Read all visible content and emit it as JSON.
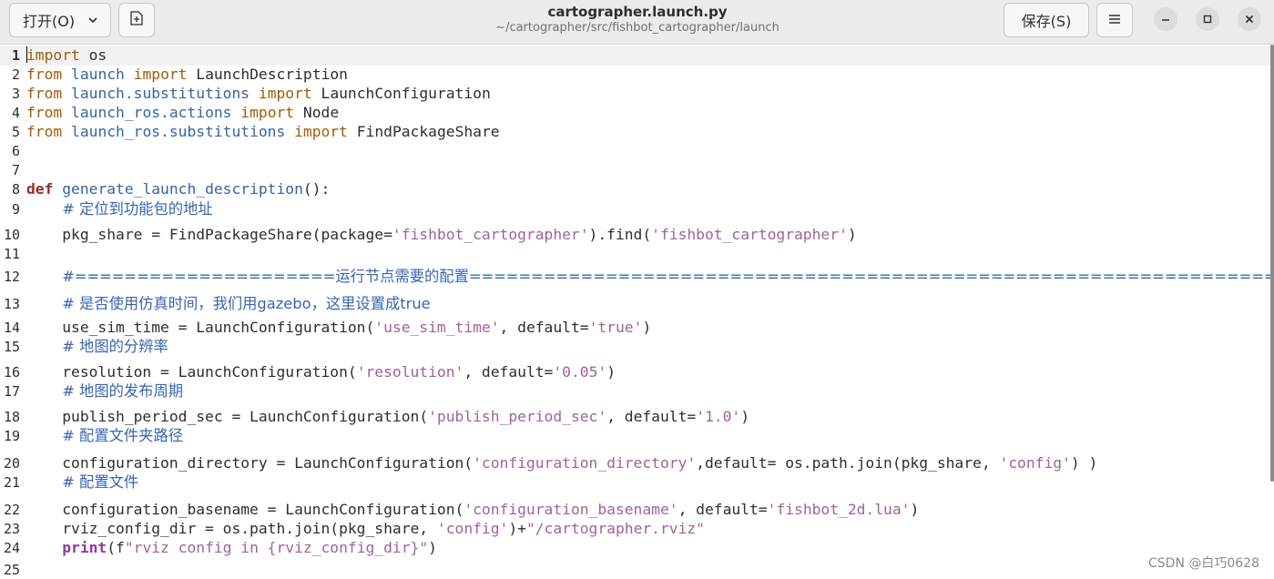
{
  "header": {
    "open_label": "打开(O)",
    "save_label": "保存(S)",
    "title": "cartographer.launch.py",
    "subtitle": "~/cartographer/src/fishbot_cartographer/launch"
  },
  "icons": {
    "open_dropdown": "chevron-down-icon",
    "new_document": "new-document-icon",
    "menu": "hamburger-menu-icon",
    "minimize": "minimize-icon",
    "maximize": "maximize-icon",
    "close": "close-icon"
  },
  "colors": {
    "keyword": "#a15c07",
    "module": "#3465a4",
    "string": "#a0629b",
    "comment": "#3a64b0",
    "builtin": "#8a3c9b",
    "def": "#a0292c"
  },
  "editor": {
    "current_line": 1,
    "lines": [
      {
        "n": "1",
        "segs": [
          [
            "kw",
            "import"
          ],
          [
            "plain",
            " os"
          ]
        ]
      },
      {
        "n": "2",
        "segs": [
          [
            "kw",
            "from"
          ],
          [
            "plain",
            " "
          ],
          [
            "mod",
            "launch"
          ],
          [
            "plain",
            " "
          ],
          [
            "kw",
            "import"
          ],
          [
            "plain",
            " LaunchDescription"
          ]
        ]
      },
      {
        "n": "3",
        "segs": [
          [
            "kw",
            "from"
          ],
          [
            "plain",
            " "
          ],
          [
            "mod",
            "launch.substitutions"
          ],
          [
            "plain",
            " "
          ],
          [
            "kw",
            "import"
          ],
          [
            "plain",
            " LaunchConfiguration"
          ]
        ]
      },
      {
        "n": "4",
        "segs": [
          [
            "kw",
            "from"
          ],
          [
            "plain",
            " "
          ],
          [
            "mod",
            "launch_ros.actions"
          ],
          [
            "plain",
            " "
          ],
          [
            "kw",
            "import"
          ],
          [
            "plain",
            " Node"
          ]
        ]
      },
      {
        "n": "5",
        "segs": [
          [
            "kw",
            "from"
          ],
          [
            "plain",
            " "
          ],
          [
            "mod",
            "launch_ros.substitutions"
          ],
          [
            "plain",
            " "
          ],
          [
            "kw",
            "import"
          ],
          [
            "plain",
            " FindPackageShare"
          ]
        ]
      },
      {
        "n": "6",
        "segs": []
      },
      {
        "n": "7",
        "segs": []
      },
      {
        "n": "8",
        "segs": [
          [
            "def",
            "def"
          ],
          [
            "plain",
            " "
          ],
          [
            "mod",
            "generate_launch_description"
          ],
          [
            "plain",
            "():"
          ]
        ]
      },
      {
        "n": "9",
        "segs": [
          [
            "plain",
            "    "
          ],
          [
            "cmt",
            "# 定位到功能包的地址"
          ]
        ]
      },
      {
        "n": "10",
        "segs": [
          [
            "plain",
            "    pkg_share = FindPackageShare(package="
          ],
          [
            "str",
            "'fishbot_cartographer'"
          ],
          [
            "plain",
            ").find("
          ],
          [
            "str",
            "'fishbot_cartographer'"
          ],
          [
            "plain",
            ")"
          ]
        ]
      },
      {
        "n": "11",
        "segs": []
      },
      {
        "n": "12",
        "segs": [
          [
            "plain",
            "    "
          ],
          [
            "cmt",
            "#=====================运行节点需要的配置========================================================================="
          ]
        ]
      },
      {
        "n": "13",
        "segs": [
          [
            "plain",
            "    "
          ],
          [
            "cmt",
            "# 是否使用仿真时间，我们用gazebo，这里设置成true"
          ]
        ]
      },
      {
        "n": "14",
        "segs": [
          [
            "plain",
            "    use_sim_time = LaunchConfiguration("
          ],
          [
            "str",
            "'use_sim_time'"
          ],
          [
            "plain",
            ", default="
          ],
          [
            "str",
            "'true'"
          ],
          [
            "plain",
            ")"
          ]
        ]
      },
      {
        "n": "15",
        "segs": [
          [
            "plain",
            "    "
          ],
          [
            "cmt",
            "# 地图的分辨率"
          ]
        ]
      },
      {
        "n": "16",
        "segs": [
          [
            "plain",
            "    resolution = LaunchConfiguration("
          ],
          [
            "str",
            "'resolution'"
          ],
          [
            "plain",
            ", default="
          ],
          [
            "str",
            "'0.05'"
          ],
          [
            "plain",
            ")"
          ]
        ]
      },
      {
        "n": "17",
        "segs": [
          [
            "plain",
            "    "
          ],
          [
            "cmt",
            "# 地图的发布周期"
          ]
        ]
      },
      {
        "n": "18",
        "segs": [
          [
            "plain",
            "    publish_period_sec = LaunchConfiguration("
          ],
          [
            "str",
            "'publish_period_sec'"
          ],
          [
            "plain",
            ", default="
          ],
          [
            "str",
            "'1.0'"
          ],
          [
            "plain",
            ")"
          ]
        ]
      },
      {
        "n": "19",
        "segs": [
          [
            "plain",
            "    "
          ],
          [
            "cmt",
            "# 配置文件夹路径"
          ]
        ]
      },
      {
        "n": "20",
        "segs": [
          [
            "plain",
            "    configuration_directory = LaunchConfiguration("
          ],
          [
            "str",
            "'configuration_directory'"
          ],
          [
            "plain",
            ",default= os.path.join(pkg_share, "
          ],
          [
            "str",
            "'config'"
          ],
          [
            "plain",
            ") )"
          ]
        ]
      },
      {
        "n": "21",
        "segs": [
          [
            "plain",
            "    "
          ],
          [
            "cmt",
            "# 配置文件"
          ]
        ]
      },
      {
        "n": "22",
        "segs": [
          [
            "plain",
            "    configuration_basename = LaunchConfiguration("
          ],
          [
            "str",
            "'configuration_basename'"
          ],
          [
            "plain",
            ", default="
          ],
          [
            "str",
            "'fishbot_2d.lua'"
          ],
          [
            "plain",
            ")"
          ]
        ]
      },
      {
        "n": "23",
        "segs": [
          [
            "plain",
            "    rviz_config_dir = os.path.join(pkg_share, "
          ],
          [
            "str",
            "'config'"
          ],
          [
            "plain",
            ")+"
          ],
          [
            "str",
            "\"/cartographer.rviz\""
          ]
        ]
      },
      {
        "n": "24",
        "segs": [
          [
            "plain",
            "    "
          ],
          [
            "bi",
            "print"
          ],
          [
            "plain",
            "(f"
          ],
          [
            "str",
            "\"rviz config in {rviz_config_dir}\""
          ],
          [
            "plain",
            ")"
          ]
        ]
      },
      {
        "n": "25",
        "segs": []
      }
    ]
  },
  "watermark": "CSDN @白巧0628"
}
